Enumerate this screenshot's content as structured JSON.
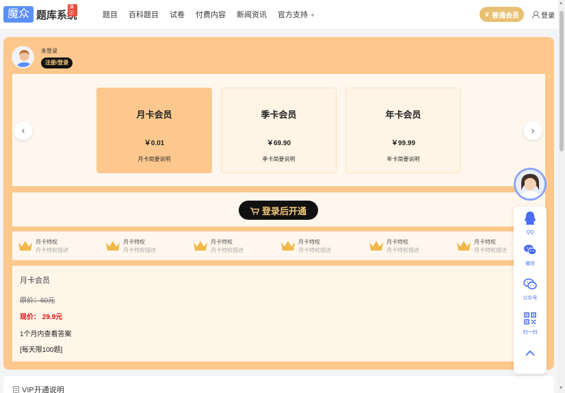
{
  "header": {
    "logo_box": "魔众",
    "logo_text": "题库系统",
    "logo_badge": "演示",
    "nav": [
      "题目",
      "百科题目",
      "试卷",
      "付费内容",
      "新闻资讯",
      "官方支持"
    ],
    "vip_label": "普通会员",
    "login_label": "登录"
  },
  "user": {
    "status": "未登录",
    "register_label": "注册/登录"
  },
  "plans": [
    {
      "name": "月卡会员",
      "price": "￥0.01",
      "desc": "月卡简要说明"
    },
    {
      "name": "季卡会员",
      "price": "￥69.90",
      "desc": "季卡简要说明"
    },
    {
      "name": "年卡会员",
      "price": "￥99.99",
      "desc": "年卡简要说明"
    }
  ],
  "open_button": "登录后开通",
  "perks": [
    {
      "title": "月卡特权",
      "desc": "月卡特权描述"
    },
    {
      "title": "月卡特权",
      "desc": "月卡特权描述"
    },
    {
      "title": "月卡特权",
      "desc": "月卡特权描述"
    },
    {
      "title": "月卡特权",
      "desc": "月卡特权描述"
    },
    {
      "title": "月卡特权",
      "desc": "月卡特权描述"
    },
    {
      "title": "月卡特权",
      "desc": "月卡特权描述"
    }
  ],
  "detail": {
    "title": "月卡会员",
    "original_price": "原价：60元",
    "current_price": "现价： 29.9元",
    "line1": "1个月内查看答案",
    "line2": "[每天限100题]"
  },
  "bottom": {
    "title": "VIP开通说明"
  },
  "float": {
    "qq_label": "QQ",
    "wechat_label": "微信",
    "official_label": "公众号",
    "scan_label": "扫一扫"
  },
  "colors": {
    "accent": "#fdc88d",
    "panel": "#fff7ee",
    "dark": "#111111",
    "gold_text": "#f5c97e",
    "link_blue": "#4a6cf7"
  }
}
